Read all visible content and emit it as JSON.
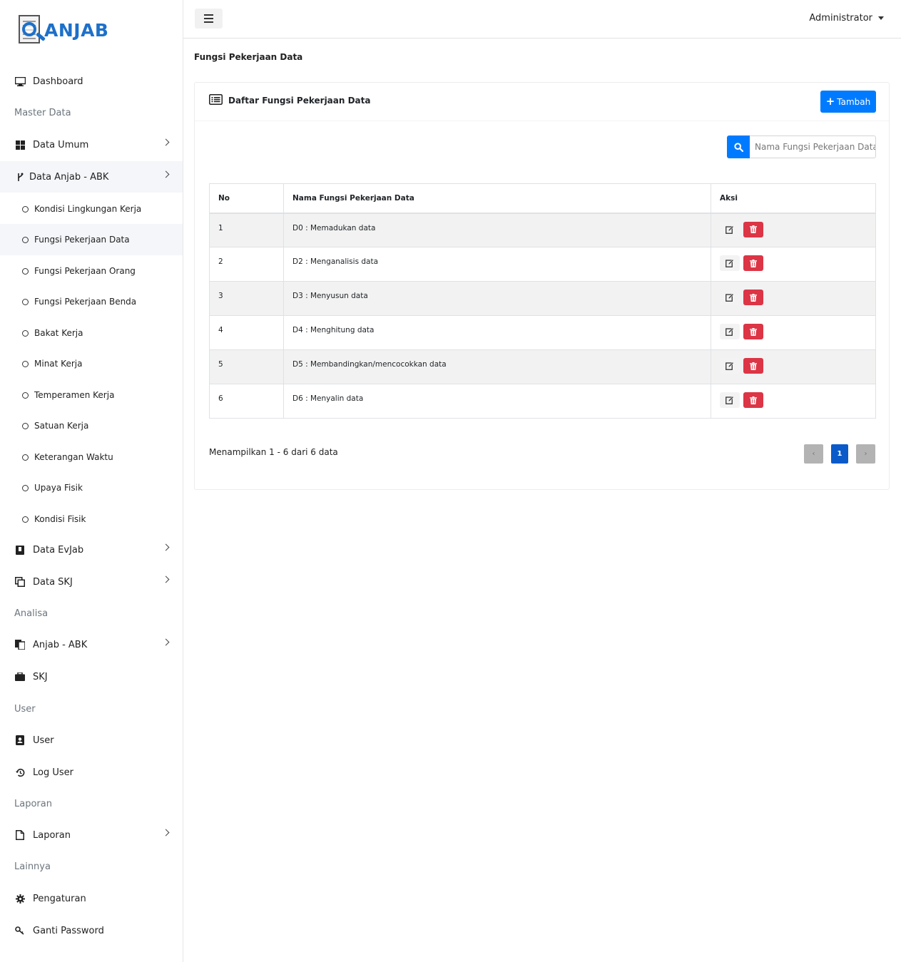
{
  "app": {
    "logo_text": "ANJAB"
  },
  "topbar": {
    "user_name": "Administrator"
  },
  "sidebar": {
    "dashboard": "Dashboard",
    "header_master": "Master Data",
    "data_umum": "Data Umum",
    "data_anjab": "Data Anjab - ABK",
    "sub_items": [
      "Kondisi Lingkungan Kerja",
      "Fungsi Pekerjaan Data",
      "Fungsi Pekerjaan Orang",
      "Fungsi Pekerjaan Benda",
      "Bakat Kerja",
      "Minat Kerja",
      "Temperamen Kerja",
      "Satuan Kerja",
      "Keterangan Waktu",
      "Upaya Fisik",
      "Kondisi Fisik"
    ],
    "data_evjab": "Data EvJab",
    "data_skj": "Data SKJ",
    "header_analisa": "Analisa",
    "anjab_abk": "Anjab - ABK",
    "skj": "SKJ",
    "header_user": "User",
    "user": "User",
    "log_user": "Log User",
    "header_laporan": "Laporan",
    "laporan": "Laporan",
    "header_lainnya": "Lainnya",
    "pengaturan": "Pengaturan",
    "ganti_password": "Ganti Password"
  },
  "page": {
    "title": "Fungsi Pekerjaan Data",
    "card_title": "Daftar Fungsi Pekerjaan Data",
    "add_button": "Tambah",
    "search_placeholder": "Nama Fungsi Pekerjaan Data"
  },
  "table": {
    "headers": [
      "No",
      "Nama Fungsi Pekerjaan Data",
      "Aksi"
    ],
    "rows": [
      {
        "no": "1",
        "name": "D0 : Memadukan data"
      },
      {
        "no": "2",
        "name": "D2 : Menganalisis data"
      },
      {
        "no": "3",
        "name": "D3 : Menyusun data"
      },
      {
        "no": "4",
        "name": "D4 : Menghitung data"
      },
      {
        "no": "5",
        "name": "D5 : Membandingkan/mencocokkan data"
      },
      {
        "no": "6",
        "name": "D6 : Menyalin data"
      }
    ]
  },
  "pagination": {
    "summary": "Menampilkan 1 - 6 dari 6 data",
    "prev": "‹",
    "current": "1",
    "next": "›"
  }
}
